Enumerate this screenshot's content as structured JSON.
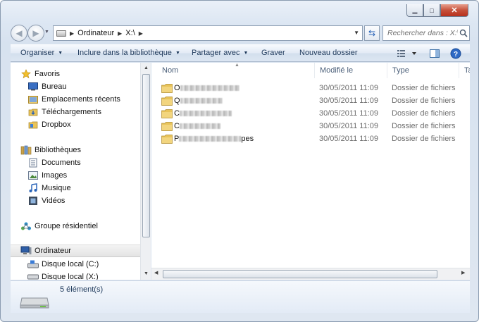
{
  "window": {
    "controls": {
      "minimize": "▁",
      "maximize": "□",
      "close": "✕"
    }
  },
  "address": {
    "segments": [
      "Ordinateur",
      "X:\\"
    ],
    "separator": "▶"
  },
  "search": {
    "placeholder": "Rechercher dans : X:\\"
  },
  "toolbar": {
    "organize": "Organiser",
    "include_library": "Inclure dans la bibliothèque",
    "share_with": "Partager avec",
    "burn": "Graver",
    "new_folder": "Nouveau dossier"
  },
  "nav": {
    "favorites": {
      "label": "Favoris",
      "items": [
        "Bureau",
        "Emplacements récents",
        "Téléchargements",
        "Dropbox"
      ]
    },
    "libraries": {
      "label": "Bibliothèques",
      "items": [
        "Documents",
        "Images",
        "Musique",
        "Vidéos"
      ]
    },
    "homegroup": {
      "label": "Groupe résidentiel"
    },
    "computer": {
      "label": "Ordinateur",
      "items": [
        "Disque local (C:)",
        "Disque local (X:)"
      ]
    }
  },
  "columns": {
    "name": "Nom",
    "modified": "Modifié le",
    "type": "Type",
    "size_partial": "Ta"
  },
  "files": [
    {
      "visible_prefix": "O",
      "visible_suffix": "",
      "modified": "30/05/2011 11:09",
      "type": "Dossier de fichiers"
    },
    {
      "visible_prefix": "Q",
      "visible_suffix": "",
      "modified": "30/05/2011 11:09",
      "type": "Dossier de fichiers"
    },
    {
      "visible_prefix": "C",
      "visible_suffix": "",
      "modified": "30/05/2011 11:09",
      "type": "Dossier de fichiers"
    },
    {
      "visible_prefix": "C",
      "visible_suffix": "",
      "modified": "30/05/2011 11:09",
      "type": "Dossier de fichiers"
    },
    {
      "visible_prefix": "P",
      "visible_suffix": "pes",
      "modified": "30/05/2011 11:09",
      "type": "Dossier de fichiers"
    }
  ],
  "status": {
    "item_count": "5 élément(s)"
  },
  "colors": {
    "accent": "#1e395b",
    "folder": "#e8c35a",
    "toolbar_text": "#1e395b"
  }
}
